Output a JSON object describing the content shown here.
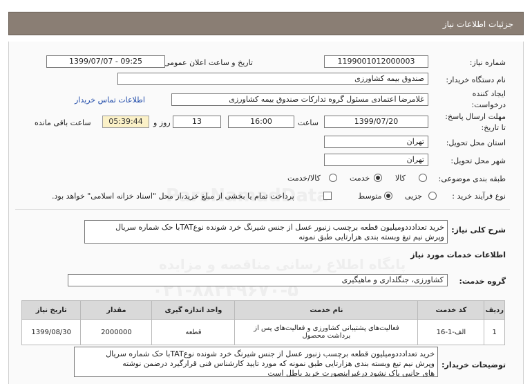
{
  "header": {
    "title": "جزئیات اطلاعات نیاز"
  },
  "fields": {
    "need_number_label": "شماره نیاز:",
    "need_number": "1199001012000003",
    "announce_label": "تاریخ و ساعت اعلان عمومی:",
    "announce_value": "1399/07/07 - 09:25",
    "buyer_label": "نام دستگاه خریدار:",
    "buyer_value": "صندوق بیمه  کشاورزی",
    "creator_label_1": "ایجاد کننده",
    "creator_label_2": "درخواست:",
    "creator_value": "غلامرضا اعتمادی مسئول گروه تدارکات صندوق بیمه  کشاورزی",
    "contact_link": "اطلاعات تماس خریدار",
    "deadline_label_1": "مهلت ارسال پاسخ:",
    "deadline_label_2": "تا تاریخ:",
    "deadline_date": "1399/07/20",
    "time_label": "ساعت",
    "deadline_time": "16:00",
    "days_value": "13",
    "days_label": "روز و",
    "remaining_time": "05:39:44",
    "remaining_label": "ساعت باقی مانده",
    "province_label": "استان محل تحویل:",
    "province_value": "تهران",
    "city_label": "شهر محل تحویل:",
    "city_value": "تهران",
    "category_label": "طبقه بندی موضوعی:",
    "category_options": [
      "کالا",
      "خدمت",
      "کالا/خدمت"
    ],
    "category_selected": "خدمت",
    "process_label": "نوع فرآیند خرید :",
    "process_options": [
      "جزیی",
      "متوسط"
    ],
    "process_selected": "متوسط",
    "treasury_note": "پرداخت تمام یا بخشی از مبلغ خرید،از محل \"اسناد خزانه اسلامی\" خواهد بود."
  },
  "summary": {
    "label": "شرح کلی نیاز:",
    "text_line1": "خرید تعدادددومیلیون قطعه برچسب زنبور عسل از جنس شیرنگ خرد شونده نوعTATبا حک شماره سریال",
    "text_line2": "وپرش نیم تیغ وبسته بندی هزارتایی طبق نمونه"
  },
  "services_section": {
    "title": "اطلاعات خدمات مورد نیاز"
  },
  "service_group": {
    "label": "گروه خدمت:",
    "value": "کشاورزی، جنگلداری و ماهیگیری"
  },
  "table": {
    "headers": [
      "ردیف",
      "کد خدمت",
      "نام خدمت",
      "واحد اندازه گیری",
      "مقدار",
      "تاریخ نیاز"
    ],
    "rows": [
      {
        "index": "1",
        "code": "الف-1-16",
        "name_line1": "فعالیت‌های پشتیبانی کشاورزی و فعالیت‌های پس از",
        "name_line2": "برداشت محصول",
        "unit": "قطعه",
        "qty": "2000000",
        "date": "1399/08/30"
      }
    ]
  },
  "description": {
    "label": "توضیحات خریدار:",
    "line1": "خرید تعدادددومیلیون قطعه برچسب زنبور عسل از جنس شیرنگ خرد شونده نوعTATبا حک شماره سریال",
    "line2": "وپرش نیم تیغ وبسته بندی هزارتایی طبق نمونه که مورد تایید کارشناس فنی قرارگیرد درضمن نوشته",
    "line3": "های جانبی پاک نشود درغیراینصورت خرید باطل است"
  },
  "watermark": {
    "line1": "ParsNamadData",
    "line2": "پایگاه اطلاع رسانی مناقصه و مزایده",
    "line3": "۰۲۱-۸۸۳۴۹۶۷۰-۵"
  }
}
